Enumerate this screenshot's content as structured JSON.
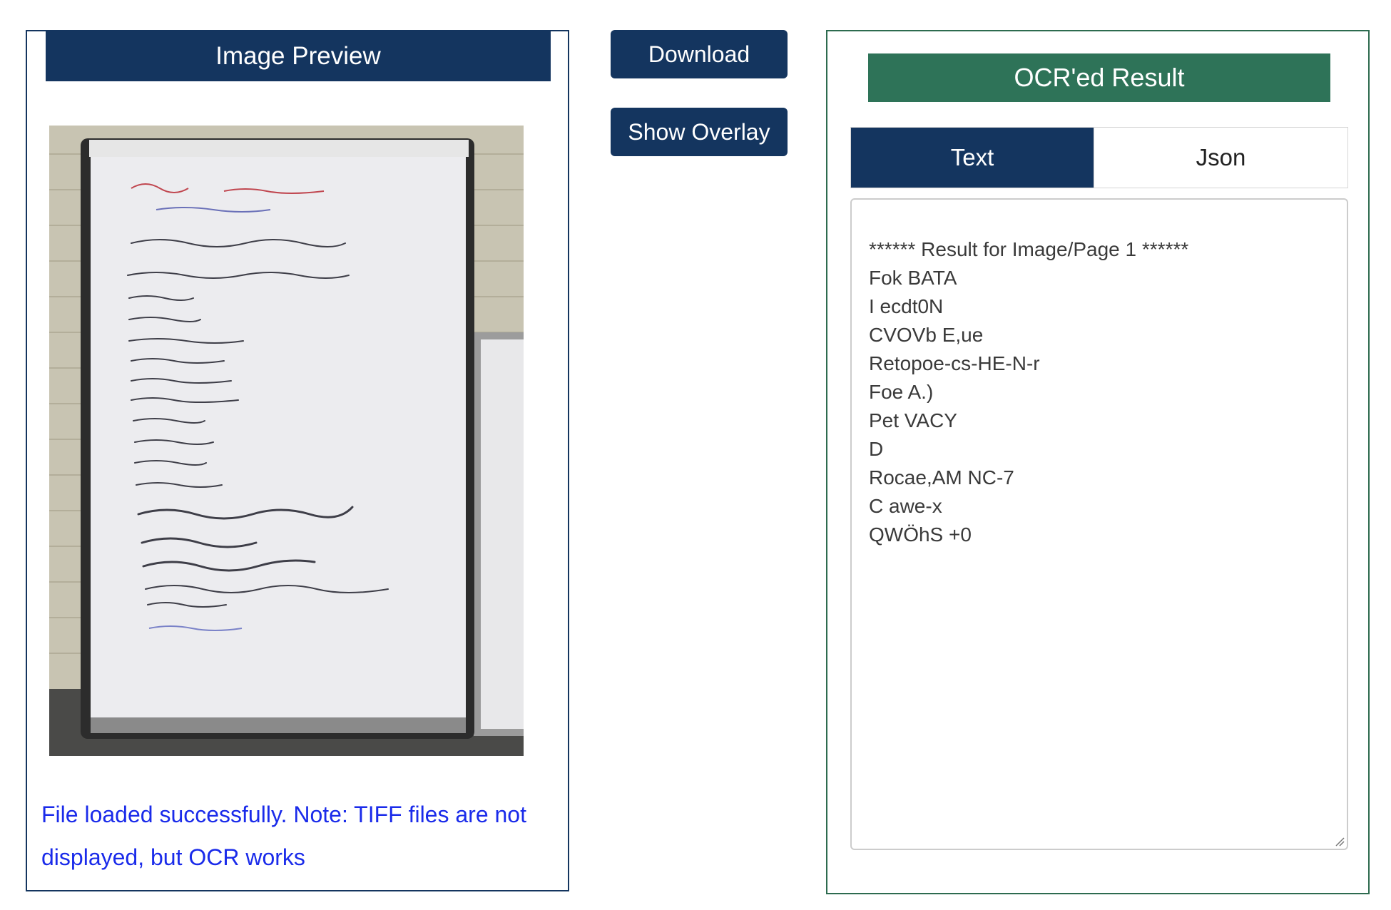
{
  "left_panel": {
    "title": "Image Preview",
    "status_message": "File loaded successfully. Note: TIFF files are not displayed, but OCR works"
  },
  "actions": {
    "download_label": "Download",
    "overlay_label": "Show Overlay"
  },
  "right_panel": {
    "title": "OCR'ed Result",
    "tabs": [
      {
        "label": "Text",
        "active": true
      },
      {
        "label": "Json",
        "active": false
      }
    ],
    "result_lines": [
      "****** Result for Image/Page 1 ******",
      "Fok BATA",
      "I ecdt0N",
      "CVOVb E,ue",
      "Retopoe-cs-HE-N-r",
      "Foe A.)",
      "Pet VACY",
      "D",
      "Rocae,AM NC-7",
      "C awe-x",
      "QWÖhS +0"
    ]
  },
  "colors": {
    "navy": "#14355f",
    "green": "#2e7358",
    "status_blue": "#1a2bea"
  },
  "icons": [
    "resize-grip-icon"
  ]
}
